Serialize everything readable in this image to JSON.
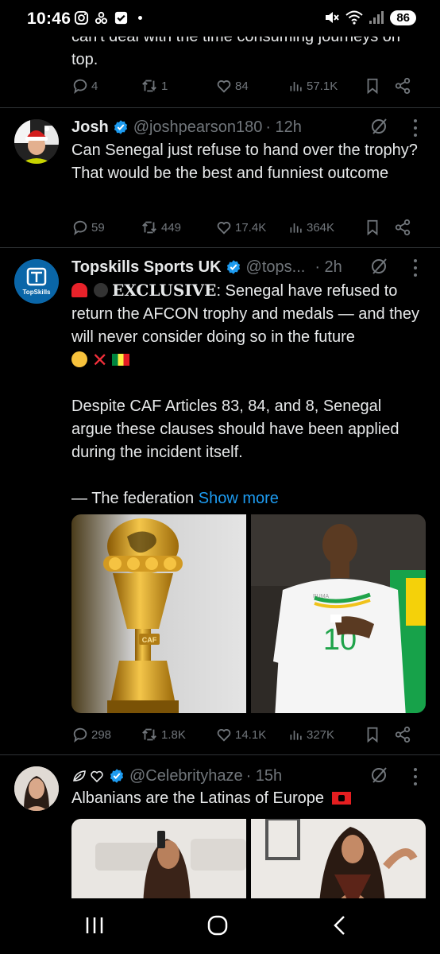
{
  "status_bar": {
    "time": "10:46",
    "battery": "86"
  },
  "tweets": [
    {
      "text_tail": "can't deal with the time consuming journeys on top.",
      "replies": "4",
      "retweets": "1",
      "likes": "84",
      "views": "57.1K"
    },
    {
      "name": "Josh",
      "handle": "@joshpearson180",
      "time": "· 12h",
      "text": "Can Senegal just refuse to hand over the trophy? That would be the best and funniest outcome",
      "replies": "59",
      "retweets": "449",
      "likes": "17.4K",
      "views": "364K"
    },
    {
      "name": "Topskills Sports UK",
      "handle": "@tops...",
      "time": "· 2h",
      "avatar_text": "TopSkills",
      "exclusive_label": "EXCLUSIVE",
      "text_p1_rest": ": Senegal have refused to return the AFCON trophy and medals — and they will never consider doing so in the future",
      "text_p2": "Despite CAF Articles 83, 84, and 8, Senegal argue these clauses should have been applied during the incident itself.",
      "text_p3": "— The federation",
      "show_more": "Show more",
      "trophy_label": "CAF",
      "jersey_number": "10",
      "jersey_brand": "PUMA",
      "replies": "298",
      "retweets": "1.8K",
      "likes": "14.1K",
      "views": "327K"
    },
    {
      "name": "",
      "handle": "@Celebrityhaze",
      "time": "· 15h",
      "text": "Albanians are the Latinas of Europe"
    }
  ],
  "icons": {
    "reply": "reply-icon",
    "retweet": "retweet-icon",
    "like": "heart-icon",
    "views": "views-icon",
    "bookmark": "bookmark-icon",
    "share": "share-icon",
    "grok": "grok-icon",
    "more": "more-icon",
    "verified": "verified-badge-icon"
  },
  "colors": {
    "background": "#000000",
    "text": "#e7e9ea",
    "muted": "#71767b",
    "link": "#1d9bf0",
    "divider": "#2f3336"
  }
}
